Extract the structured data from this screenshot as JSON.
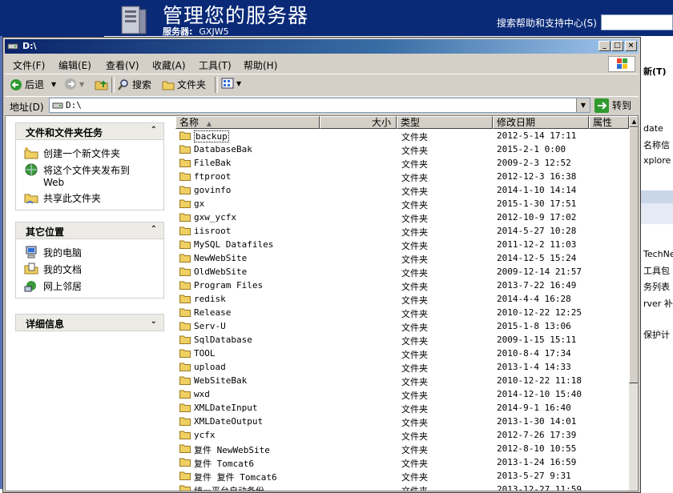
{
  "background": {
    "title": "管理您的服务器",
    "server_label": "服务器:",
    "server_name": "GXJW5",
    "search_label": "搜索帮助和支持中心(S)",
    "right_fragments": [
      "新(T)",
      "date",
      "名称信",
      "xplore",
      "TechNe",
      "工具包",
      "务列表",
      "rver 补",
      "保护计"
    ]
  },
  "window": {
    "title": "D:\\",
    "controls": {
      "minimize": "_",
      "maximize": "□",
      "close": "×"
    }
  },
  "menu": [
    "文件(F)",
    "编辑(E)",
    "查看(V)",
    "收藏(A)",
    "工具(T)",
    "帮助(H)"
  ],
  "toolbar": {
    "back": "后退",
    "search": "搜索",
    "folders": "文件夹"
  },
  "address": {
    "label": "地址(D)",
    "value": "D:\\",
    "go": "转到"
  },
  "taskpane": {
    "file_tasks": {
      "title": "文件和文件夹任务",
      "items": [
        "创建一个新文件夹",
        "将这个文件夹发布到 Web",
        "共享此文件夹"
      ]
    },
    "other_places": {
      "title": "其它位置",
      "items": [
        "我的电脑",
        "我的文档",
        "网上邻居"
      ]
    },
    "details": {
      "title": "详细信息"
    }
  },
  "columns": {
    "name": "名称",
    "size": "大小",
    "type": "类型",
    "modified": "修改日期",
    "attributes": "属性"
  },
  "files": [
    {
      "name": "backup",
      "type": "文件夹",
      "modified": "2012-5-14 17:11"
    },
    {
      "name": "DatabaseBak",
      "type": "文件夹",
      "modified": "2015-2-1 0:00"
    },
    {
      "name": "FileBak",
      "type": "文件夹",
      "modified": "2009-2-3 12:52"
    },
    {
      "name": "ftproot",
      "type": "文件夹",
      "modified": "2012-12-3 16:38"
    },
    {
      "name": "govinfo",
      "type": "文件夹",
      "modified": "2014-1-10 14:14"
    },
    {
      "name": "gx",
      "type": "文件夹",
      "modified": "2015-1-30 17:51"
    },
    {
      "name": "gxw_ycfx",
      "type": "文件夹",
      "modified": "2012-10-9 17:02"
    },
    {
      "name": "iisroot",
      "type": "文件夹",
      "modified": "2014-5-27 10:28"
    },
    {
      "name": "MySQL Datafiles",
      "type": "文件夹",
      "modified": "2011-12-2 11:03"
    },
    {
      "name": "NewWebSite",
      "type": "文件夹",
      "modified": "2014-12-5 15:24"
    },
    {
      "name": "OldWebSite",
      "type": "文件夹",
      "modified": "2009-12-14 21:57"
    },
    {
      "name": "Program Files",
      "type": "文件夹",
      "modified": "2013-7-22 16:49"
    },
    {
      "name": "redisk",
      "type": "文件夹",
      "modified": "2014-4-4 16:28"
    },
    {
      "name": "Release",
      "type": "文件夹",
      "modified": "2010-12-22 12:25"
    },
    {
      "name": "Serv-U",
      "type": "文件夹",
      "modified": "2015-1-8 13:06"
    },
    {
      "name": "SqlDatabase",
      "type": "文件夹",
      "modified": "2009-1-15 15:11"
    },
    {
      "name": "TOOL",
      "type": "文件夹",
      "modified": "2010-8-4 17:34"
    },
    {
      "name": "upload",
      "type": "文件夹",
      "modified": "2013-1-4 14:33"
    },
    {
      "name": "WebSiteBak",
      "type": "文件夹",
      "modified": "2010-12-22 11:18"
    },
    {
      "name": "wxd",
      "type": "文件夹",
      "modified": "2014-12-10 15:40"
    },
    {
      "name": "XMLDateInput",
      "type": "文件夹",
      "modified": "2014-9-1 16:40"
    },
    {
      "name": "XMLDateOutput",
      "type": "文件夹",
      "modified": "2013-1-30 14:01"
    },
    {
      "name": "ycfx",
      "type": "文件夹",
      "modified": "2012-7-26 17:39"
    },
    {
      "name": "复件 NewWebSite",
      "type": "文件夹",
      "modified": "2012-8-10 10:55"
    },
    {
      "name": "复件 Tomcat6",
      "type": "文件夹",
      "modified": "2013-1-24 16:59"
    },
    {
      "name": "复件 复件 Tomcat6",
      "type": "文件夹",
      "modified": "2013-5-27 9:31"
    },
    {
      "name": "统一平台自动备份",
      "type": "文件夹",
      "modified": "2013-12-27 11:59"
    }
  ]
}
